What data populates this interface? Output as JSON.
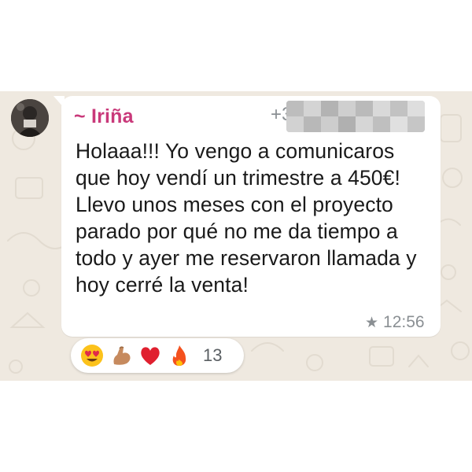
{
  "message": {
    "sender_name": "~ Iriña",
    "sender_phone_prefix": "+3",
    "text": "Holaaa!!! Yo vengo a comunicaros que hoy vendí un trimestre a 450€! Llevo unos meses con el proyecto parado por qué no me da tiempo a todo y ayer me reservaron llamada y hoy cerré la venta!",
    "time": "12:56",
    "starred_icon": "star-icon"
  },
  "reactions": {
    "emojis": [
      "heart-eyes-icon",
      "flexed-biceps-icon",
      "red-heart-icon",
      "fire-icon"
    ],
    "count": "13"
  },
  "colors": {
    "sender": "#c9397a",
    "chat_background": "#efe9e0",
    "bubble": "#ffffff",
    "meta": "#8a8f93"
  }
}
